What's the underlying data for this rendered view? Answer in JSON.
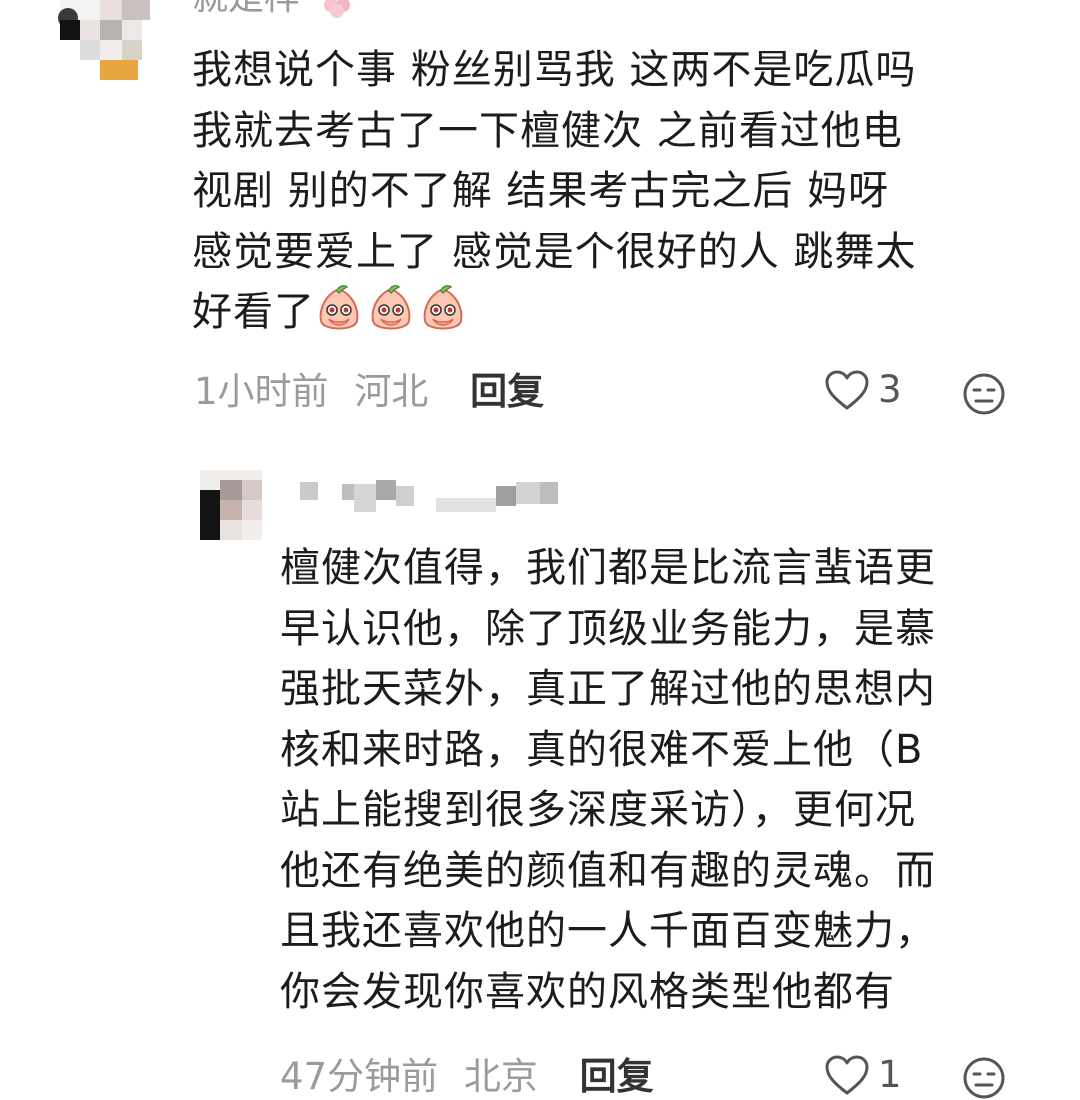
{
  "comment": {
    "author": "就是样",
    "lines": [
      "我想说个事 粉丝别骂我 这两不是吃瓜吗",
      "我就去考古了一下檀健次 之前看过他电",
      "视剧 别的不了解 结果考古完之后 妈呀",
      "感觉要爱上了 感觉是个很好的人 跳舞太",
      "好看了"
    ],
    "emoji": "peach-cover-mouth-emoji",
    "time": "1小时前",
    "location": "河北",
    "reply_label": "回复",
    "like_count": "3"
  },
  "reply": {
    "lines": [
      "檀健次值得，我们都是比流言蜚语更",
      "早认识他，除了顶级业务能力，是慕",
      "强批天菜外，真正了解过他的思想内",
      "核和来时路，真的很难不爱上他（B",
      "站上能搜到很多深度采访），更何况",
      "他还有绝美的颜值和有趣的灵魂。而",
      "且我还喜欢他的一人千面百变魅力，",
      "你会发现你喜欢的风格类型他都有"
    ],
    "time": "47分钟前",
    "location": "北京",
    "reply_label": "回复",
    "like_count": "1"
  },
  "icons": {
    "like": "heart-outline-icon",
    "dislike": "neutral-face-icon"
  }
}
